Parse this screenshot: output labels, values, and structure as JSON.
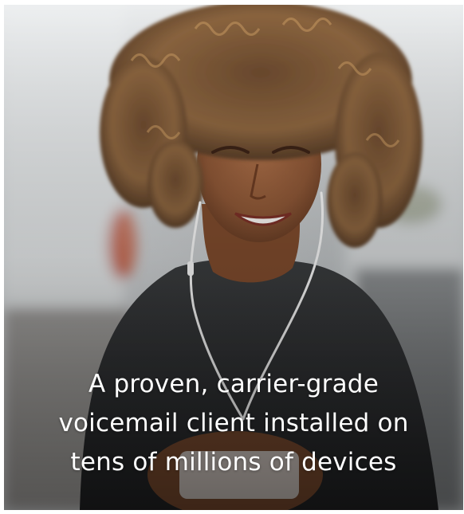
{
  "hero": {
    "image_icon": "woman-with-earphones-looking-at-phone-photo",
    "caption_lines": [
      "A proven, carrier-grade",
      "voicemail client installed on",
      "tens of millions of devices"
    ],
    "caption_color": "#ffffff"
  }
}
